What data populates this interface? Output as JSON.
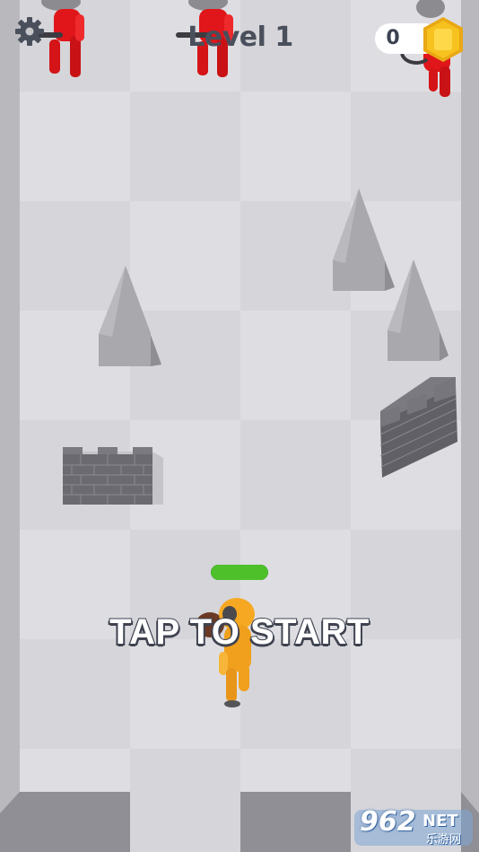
{
  "hud": {
    "level_label": "Level 1",
    "coins": "0",
    "settings_icon": "gear-icon",
    "coin_icon": "hexagon-coin-icon"
  },
  "prompt": {
    "tap_to_start": "TAP TO START"
  },
  "player": {
    "health_fraction": 1.0,
    "health_color": "#4ec12a",
    "suit_color": "#f7a823"
  },
  "enemies": {
    "color": "#e0161a",
    "count": 3
  },
  "obstacles": {
    "spikes": 3,
    "walls": 2,
    "stone_color": "#9b9ba0",
    "brick_color": "#6a6a70"
  },
  "watermark": {
    "brand": "962",
    "suffix": "NET",
    "subtitle": "乐游网"
  },
  "colors": {
    "floor": "#dedee2",
    "tile_alt": "#d5d5da",
    "hud_text": "#4a4f5c",
    "coin": "#f7c21e"
  }
}
